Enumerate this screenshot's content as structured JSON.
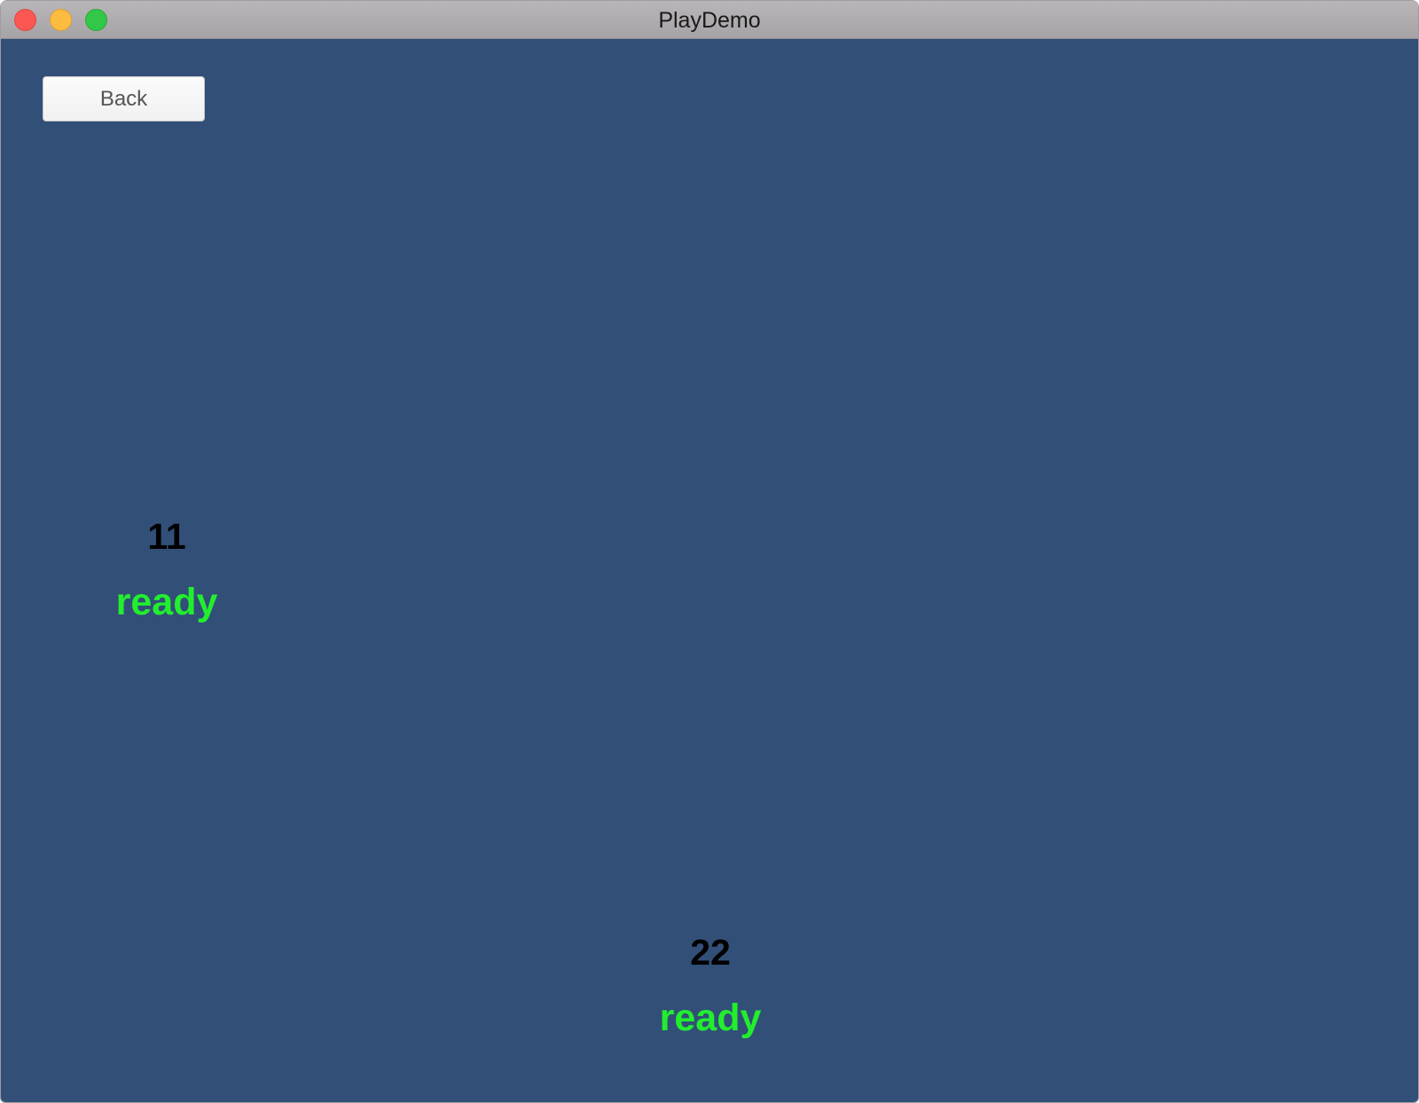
{
  "window": {
    "title": "PlayDemo"
  },
  "toolbar": {
    "back_label": "Back"
  },
  "players": [
    {
      "id": "11",
      "status": "ready"
    },
    {
      "id": "22",
      "status": "ready"
    }
  ],
  "colors": {
    "background": "#324f78",
    "status_ready": "#22ee2e",
    "player_id": "#000000"
  },
  "icons": {
    "close": "close-icon",
    "minimize": "minimize-icon",
    "zoom": "zoom-icon"
  }
}
